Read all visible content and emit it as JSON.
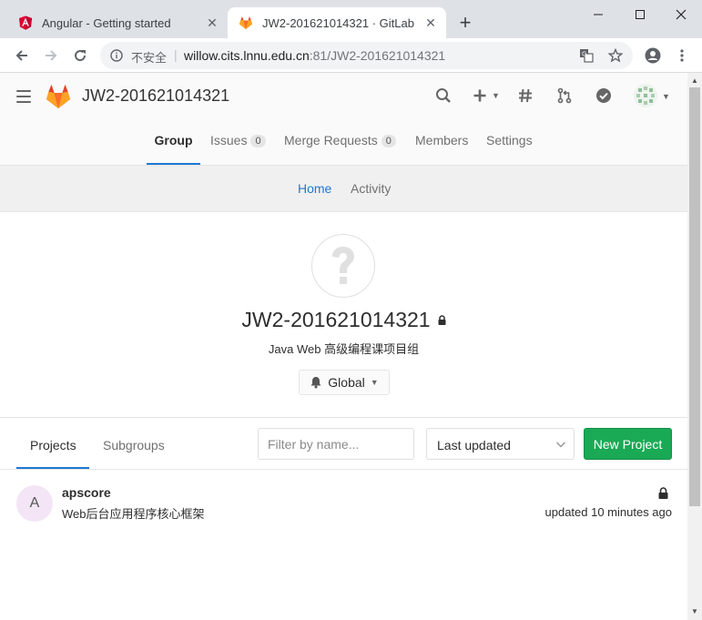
{
  "browser": {
    "tabs": [
      {
        "title": "Angular - Getting started",
        "favicon": "angular-icon",
        "active": false
      },
      {
        "title": "JW2-201621014321 · GitLab",
        "favicon": "gitlab-icon",
        "active": true
      }
    ],
    "new_tab_label": "+",
    "security_label": "不安全",
    "url_host": "willow.cits.lnnu.edu.cn",
    "url_path": ":81/JW2-201621014321"
  },
  "header": {
    "title": "JW2-201621014321"
  },
  "group_nav": {
    "items": [
      {
        "label": "Group",
        "active": true
      },
      {
        "label": "Issues",
        "count": "0"
      },
      {
        "label": "Merge Requests",
        "count": "0"
      },
      {
        "label": "Members"
      },
      {
        "label": "Settings"
      }
    ]
  },
  "subnav": {
    "items": [
      {
        "label": "Home",
        "active": true
      },
      {
        "label": "Activity"
      }
    ]
  },
  "group": {
    "name": "JW2-201621014321",
    "description": "Java Web 高级编程课项目组",
    "notification_label": "Global"
  },
  "projects": {
    "tabs": [
      {
        "label": "Projects",
        "active": true
      },
      {
        "label": "Subgroups"
      }
    ],
    "filter_placeholder": "Filter by name...",
    "sort_label": "Last updated",
    "new_project_label": "New Project",
    "items": [
      {
        "avatar_letter": "A",
        "name": "apscore",
        "description": "Web后台应用程序核心框架",
        "updated": "updated 10 minutes ago",
        "private": true
      }
    ]
  },
  "colors": {
    "accent": "#1f78d1",
    "success": "#1aaa55",
    "gitlab_orange": "#fc6d26"
  }
}
